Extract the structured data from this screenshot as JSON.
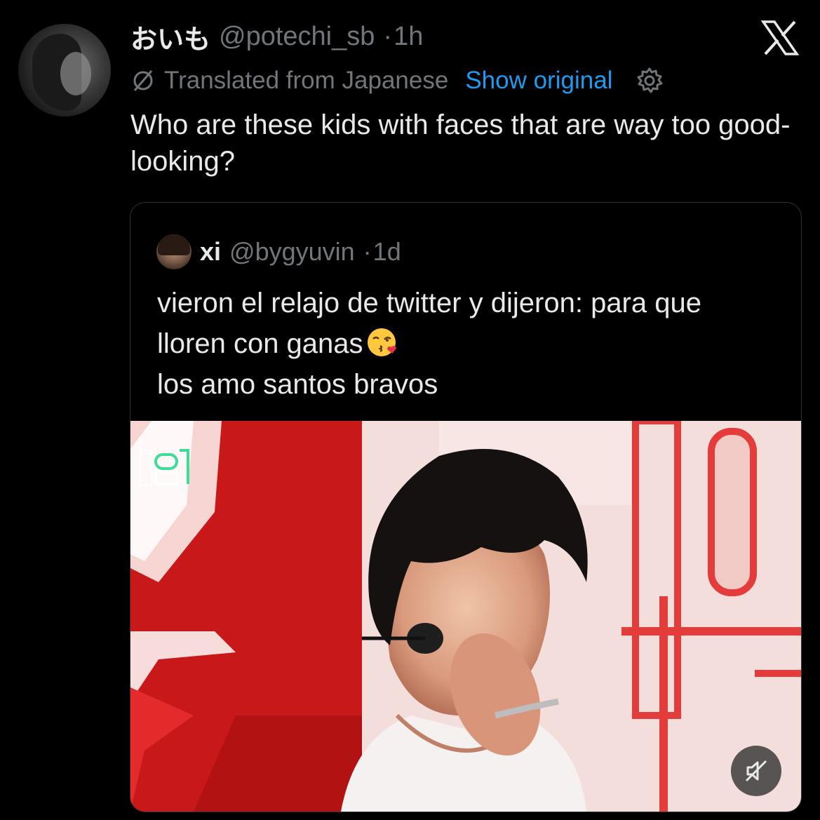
{
  "tweet": {
    "display_name": "おいも",
    "handle": "@potechi_sb",
    "separator": "·",
    "time": "1h",
    "translated_label": "Translated from Japanese",
    "show_original": "Show original",
    "text": "Who are these kids with faces that are way too good-looking?"
  },
  "quote": {
    "display_name": "xi",
    "handle": "@bygyuvin",
    "separator": "·",
    "time": "1d",
    "lines": [
      "vieron el relajo de twitter y dijeron: para que",
      "lloren con ganas",
      "los amo santos bravos"
    ],
    "emoji": "face-blowing-a-kiss",
    "media": {
      "watermark": "SHOW 음중",
      "description_icon": "video-thumbnail"
    }
  },
  "icons": {
    "x_logo": "x-logo-icon",
    "no_translate": "slashed-circle-icon",
    "gear": "gear-icon",
    "mute": "muted-speaker-icon"
  },
  "colors": {
    "background": "#000000",
    "text": "#e7e9ea",
    "secondary": "#71767b",
    "link": "#1d9bf0"
  }
}
